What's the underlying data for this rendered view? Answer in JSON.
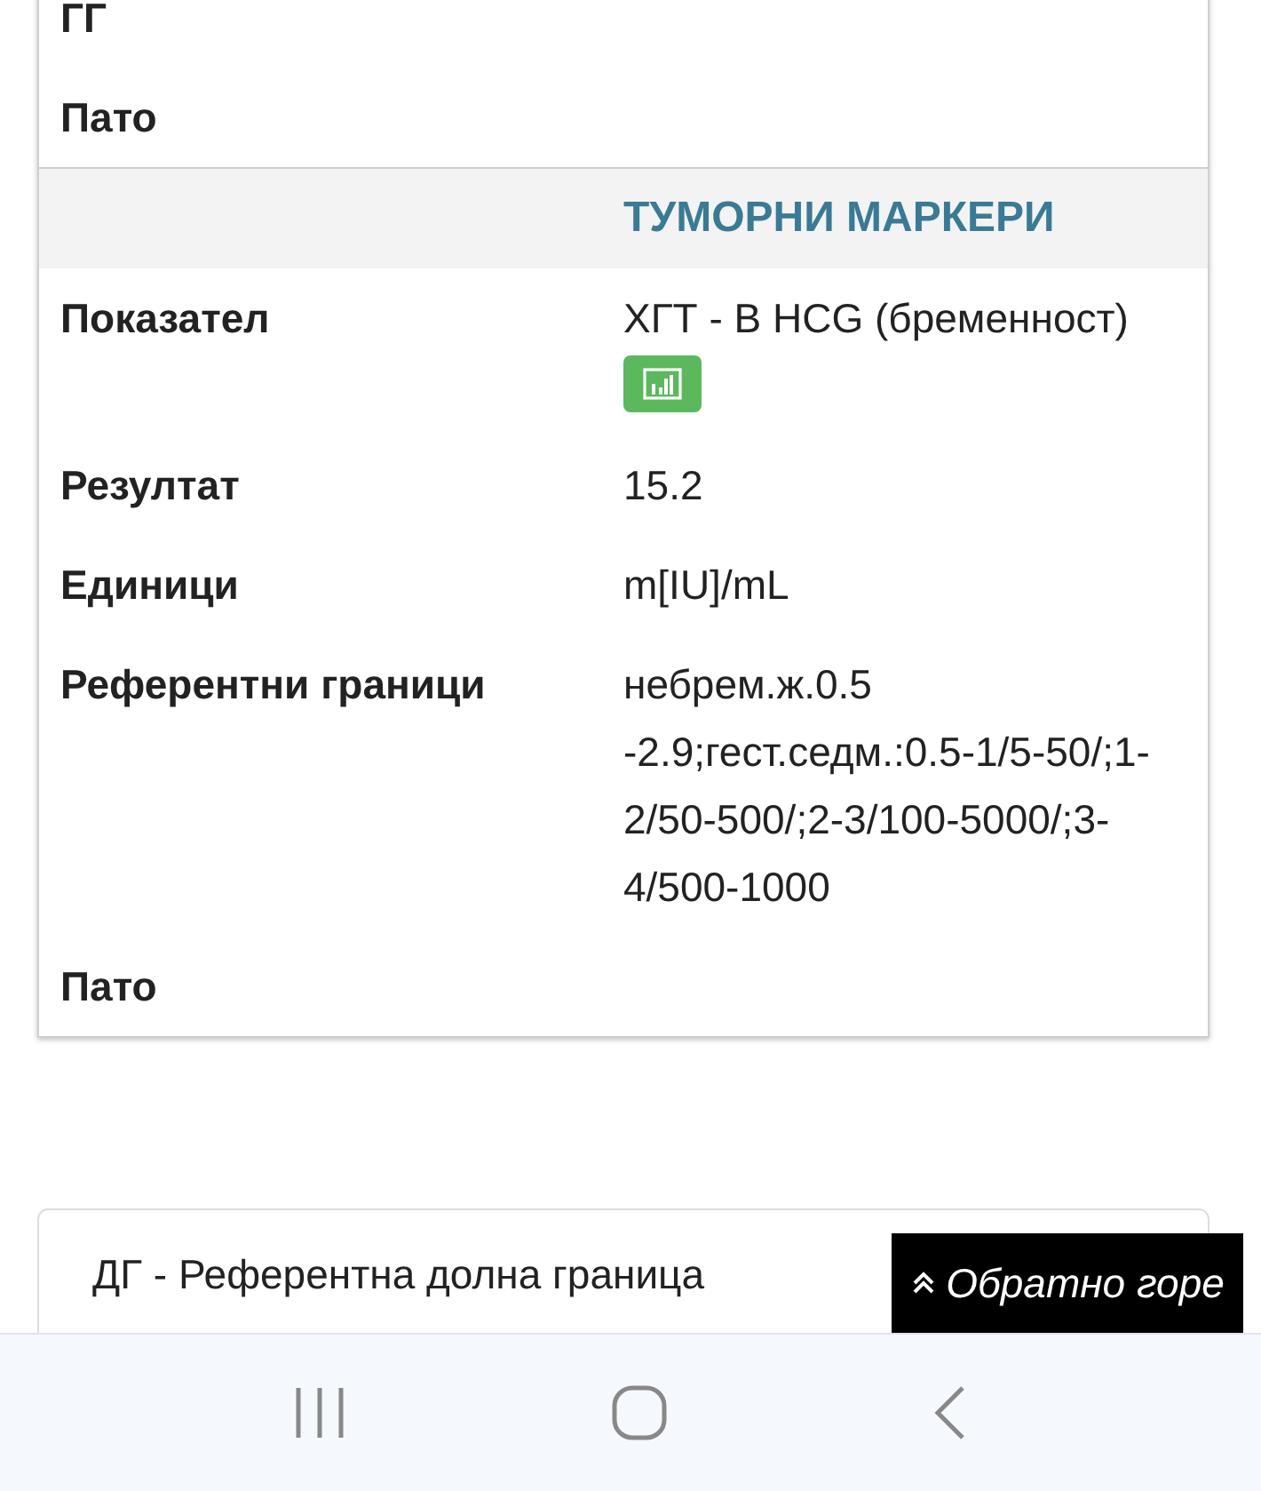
{
  "top_card": {
    "rows": [
      {
        "label": "ГГ"
      },
      {
        "label": "Пато"
      }
    ]
  },
  "section": {
    "title": "ТУМОРНИ МАРКЕРИ",
    "rows": [
      {
        "label": "Показател",
        "value": "ХГТ - B HCG (бременност)",
        "chart_button": true
      },
      {
        "label": "Резултат",
        "value": "15.2"
      },
      {
        "label": "Единици",
        "value": "m[IU]/mL"
      },
      {
        "label": "Референтни граници",
        "value": "небрем.ж.0.5 -2.9;гест.седм.:0.5-1/5-50/;1-2/50-500/;2-3/100-5000/;3-4/500-1000"
      },
      {
        "label": "Пато"
      }
    ]
  },
  "legend": [
    "ДГ - Референтна долна граница"
  ],
  "back_to_top": "Обратно горе"
}
